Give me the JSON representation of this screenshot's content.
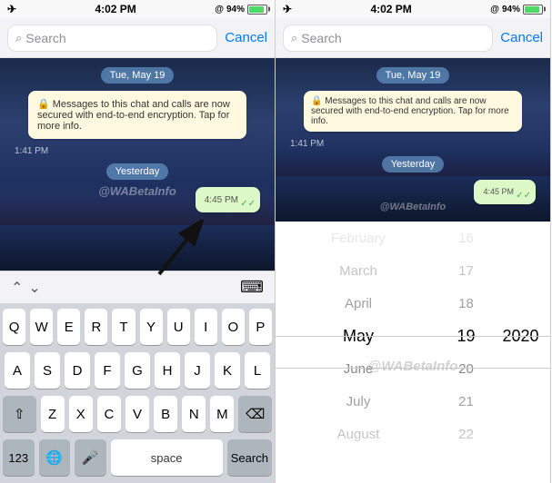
{
  "left_panel": {
    "status": {
      "time": "4:02 PM",
      "battery": "94%",
      "battery_level": 94
    },
    "search_bar": {
      "placeholder": "Search",
      "cancel_label": "Cancel"
    },
    "chat": {
      "date_label": "Tue, May 19",
      "system_message": "Messages to this chat and calls are now secured with end-to-end encryption. Tap for more info.",
      "time_1": "1:41 PM",
      "yesterday_label": "Yesterday",
      "time_2": "4:45 PM",
      "watermark": "@WABetaInfo"
    },
    "toolbar": {
      "chevron_up": "^",
      "chevron_down": "v"
    },
    "keyboard": {
      "rows": [
        [
          "Q",
          "W",
          "E",
          "R",
          "T",
          "Y",
          "U",
          "I",
          "O",
          "P"
        ],
        [
          "A",
          "S",
          "D",
          "F",
          "G",
          "H",
          "J",
          "K",
          "L"
        ],
        [
          "Z",
          "X",
          "C",
          "V",
          "B",
          "N",
          "M"
        ]
      ],
      "bottom": {
        "numbers": "123",
        "space": "space",
        "search": "Search"
      }
    }
  },
  "right_panel": {
    "status": {
      "time": "4:02 PM",
      "battery": "94%"
    },
    "search_bar": {
      "placeholder": "Search",
      "cancel_label": "Cancel"
    },
    "chat": {
      "date_label": "Tue, May 19",
      "system_message": "Messages to this chat and calls are now secured with end-to-end encryption. Tap for more info.",
      "time_1": "1:41 PM",
      "yesterday_label": "Yesterday",
      "time_2": "4:45 PM",
      "watermark": "@WABetaInfo"
    },
    "date_picker": {
      "months": [
        "February",
        "March",
        "April",
        "May",
        "June",
        "July",
        "August"
      ],
      "days": [
        16,
        17,
        18,
        19,
        20,
        21,
        22
      ],
      "years": [
        2020
      ],
      "selected_month": "May",
      "selected_day": 19,
      "selected_year": 2020
    }
  }
}
